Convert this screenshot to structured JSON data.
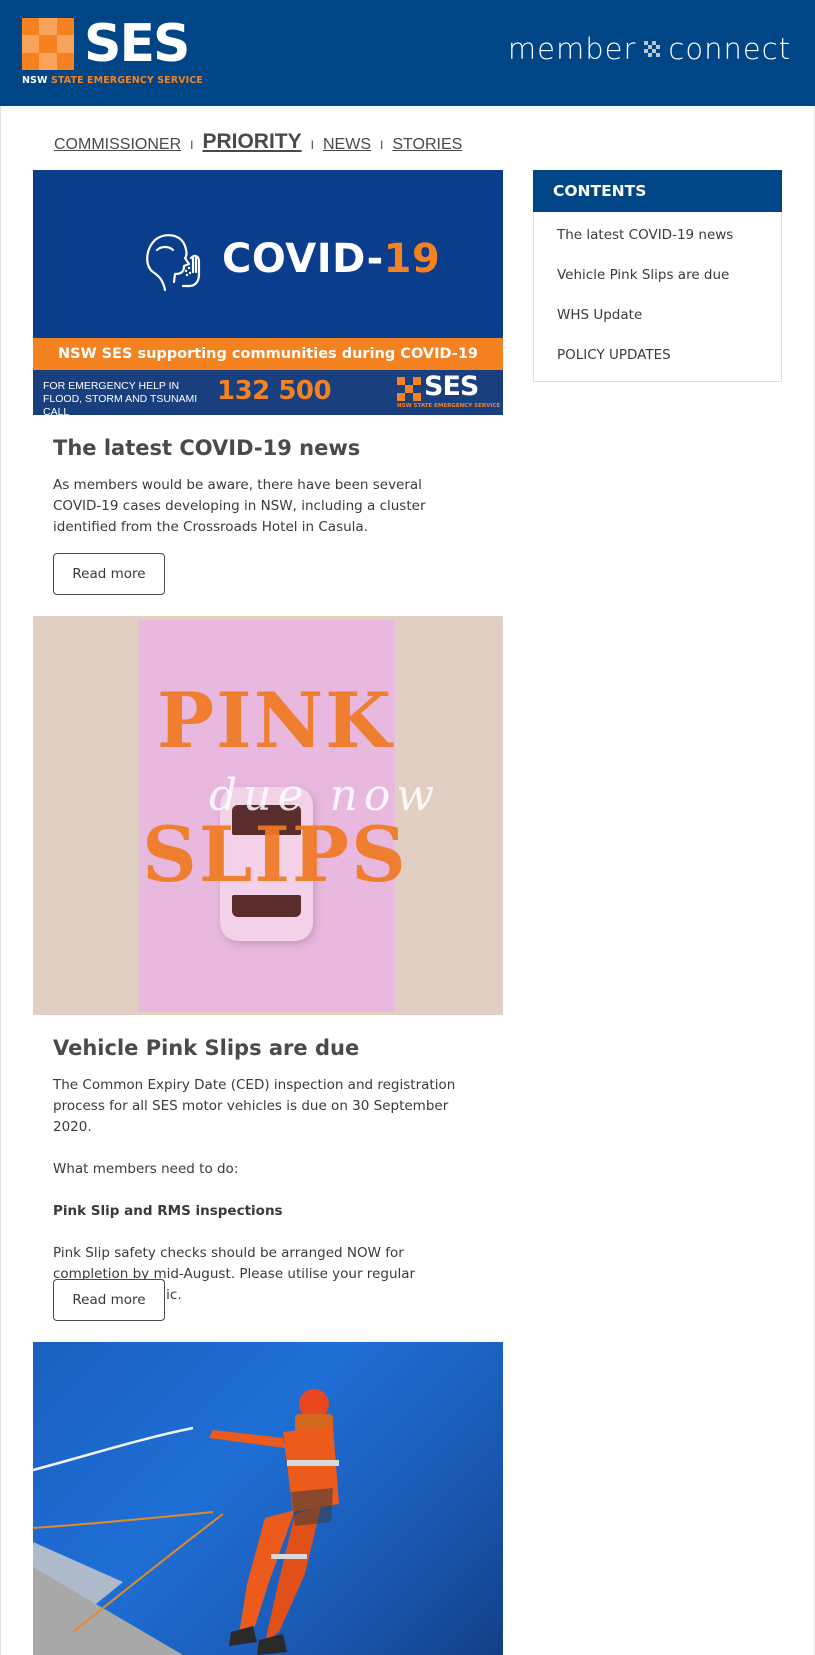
{
  "header": {
    "logo_text": "SES",
    "logo_sub_prefix": "NSW",
    "logo_sub_rest": " STATE EMERGENCY SERVICE",
    "brand_left": "member",
    "brand_right": "connect"
  },
  "nav": {
    "items": [
      {
        "label": "COMMISSIONER"
      },
      {
        "label": "PRIORITY"
      },
      {
        "label": "NEWS"
      },
      {
        "label": "STORIES"
      }
    ],
    "separator": "I"
  },
  "covid_banner": {
    "title_prefix": "COVID-",
    "title_number": "19",
    "strip": "NSW SES supporting communities during COVID-19",
    "footer_text": "FOR EMERGENCY HELP IN FLOOD, STORM AND TSUNAMI CALL",
    "phone": "132 500",
    "logo_text": "SES",
    "logo_sub": "NSW STATE EMERGENCY SERVICE"
  },
  "articles": [
    {
      "title": "The latest COVID-19 news",
      "paragraphs": [
        "As members would be aware, there have been several COVID-19 cases developing in NSW, including a cluster identified from the Crossroads Hotel in Casula."
      ],
      "button": "Read more"
    },
    {
      "title": "Vehicle Pink Slips are due",
      "paragraphs": [
        "The Common Expiry Date (CED) inspection and registration process for all SES motor vehicles is due on 30 September 2020.",
        "What members need to do:",
        "Pink Slip and RMS inspections",
        "Pink Slip safety checks should be arranged NOW for completion by mid-August. Please utilise your regular ‘sgfleet’ mechanic."
      ],
      "button": "Read more"
    }
  ],
  "pink_image": {
    "word1": "PINK",
    "word2": "SLIPS",
    "script": "due now"
  },
  "sidebar": {
    "heading": "CONTENTS",
    "items": [
      {
        "label": "The latest COVID-19 news"
      },
      {
        "label": "Vehicle Pink Slips are due"
      },
      {
        "label": "WHS Update"
      },
      {
        "label": "POLICY UPDATES"
      }
    ]
  },
  "colors": {
    "brand_blue": "#004586",
    "brand_orange": "#f58220"
  }
}
